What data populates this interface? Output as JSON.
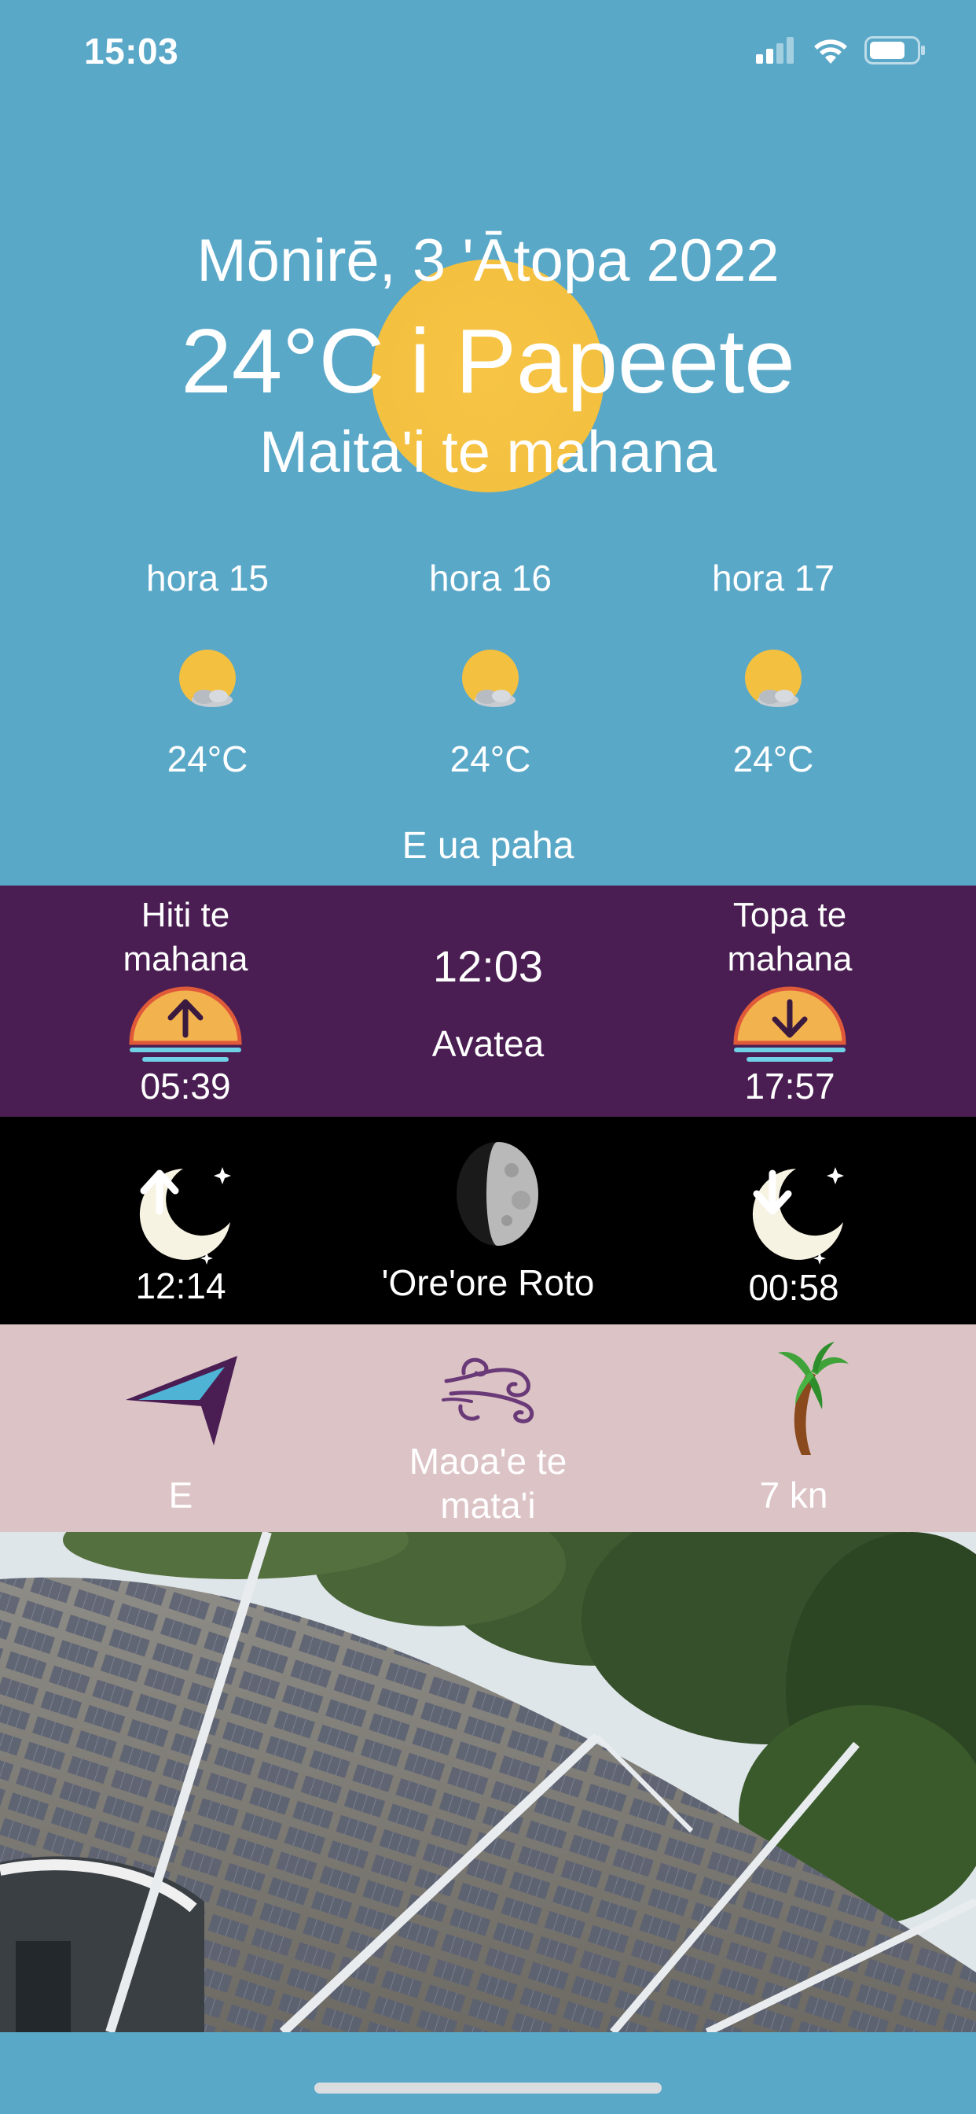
{
  "status_bar": {
    "time": "15:03",
    "icons": [
      "signal-icon",
      "wifi-icon",
      "battery-icon"
    ]
  },
  "header": {
    "date": "Mōnirē, 3 'Ātopa 2022",
    "temperature_city": "24°C i Papeete",
    "condition": "Maita'i te mahana"
  },
  "hourly": [
    {
      "label": "hora 15",
      "temp": "24°C",
      "icon": "sun-cloud-icon"
    },
    {
      "label": "hora 16",
      "temp": "24°C",
      "icon": "sun-cloud-icon"
    },
    {
      "label": "hora 17",
      "temp": "24°C",
      "icon": "sun-cloud-icon"
    }
  ],
  "summary": "E ua paha",
  "sun": {
    "sunrise_label_1": "Hiti te",
    "sunrise_label_2": "mahana",
    "sunrise_time": "05:39",
    "noon_time": "12:03",
    "noon_label": "Avatea",
    "sunset_label_1": "Topa te",
    "sunset_label_2": "mahana",
    "sunset_time": "17:57"
  },
  "moon": {
    "moonrise_time": "12:14",
    "phase_label": "'Ore'ore Roto",
    "moonset_time": "00:58"
  },
  "wind": {
    "direction": "E",
    "condition_1": "Maoa'e te",
    "condition_2": "mata'i",
    "speed": "7 kn"
  },
  "colors": {
    "sky": "#5aa8c8",
    "sun_band": "#4a1e52",
    "moon_band": "#000000",
    "wind_band": "#dcc3c6",
    "sun": "#f4c040"
  }
}
